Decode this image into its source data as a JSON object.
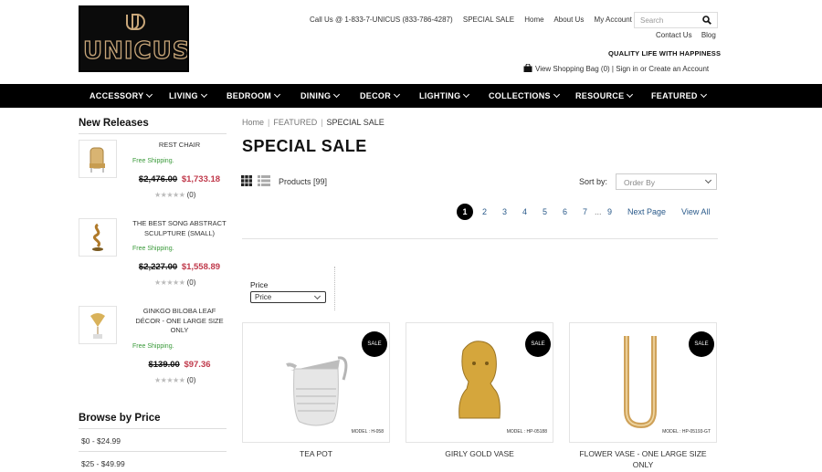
{
  "logo": {
    "text": "UNICUS"
  },
  "header": {
    "call": "Call Us @ 1-833-7-UNICUS (833-786-4287)",
    "special_sale": "SPECIAL SALE",
    "home": "Home",
    "about": "About Us",
    "account": "My Account",
    "search_placeholder": "Search",
    "contact": "Contact Us",
    "blog": "Blog",
    "tagline": "QUALITY LIFE WITH HAPPINESS",
    "bag": "View Shopping Bag (0)",
    "sign_in": "Sign in",
    "or": "or",
    "create": "Create an Account"
  },
  "nav": [
    "ACCESSORY",
    "LIVING",
    "BEDROOM",
    "DINING",
    "DECOR",
    "LIGHTING",
    "COLLECTIONS",
    "RESOURCE",
    "FEATURED"
  ],
  "sidebar": {
    "new_releases": "New Releases",
    "products": [
      {
        "name": "REST CHAIR",
        "shipping": "Free Shipping.",
        "old": "$2,476.00",
        "new": "$1,733.18",
        "reviews": "(0)"
      },
      {
        "name": "THE BEST SONG ABSTRACT SCULPTURE (SMALL)",
        "shipping": "Free Shipping.",
        "old": "$2,227.00",
        "new": "$1,558.89",
        "reviews": "(0)"
      },
      {
        "name": "GINKGO BILOBA LEAF DÉCOR - ONE LARGE SIZE ONLY",
        "shipping": "Free Shipping.",
        "old": "$139.00",
        "new": "$97.36",
        "reviews": "(0)"
      }
    ],
    "browse_title": "Browse by Price",
    "browse": [
      "$0 - $24.99",
      "$25 - $49.99"
    ]
  },
  "main": {
    "breadcrumb": [
      "Home",
      "FEATURED",
      "SPECIAL SALE"
    ],
    "title": "SPECIAL SALE",
    "count": "Products [99]",
    "sort_label": "Sort by:",
    "sort_value": "Order By",
    "pages": [
      "1",
      "2",
      "3",
      "4",
      "5",
      "6",
      "7",
      "...",
      "9"
    ],
    "next": "Next Page",
    "view_all": "View All",
    "filter_label": "Price",
    "filter_value": "Price",
    "products": [
      {
        "name": "TEA POT",
        "badge": "SALE",
        "model": "MODEL : H-058"
      },
      {
        "name": "GIRLY GOLD VASE",
        "badge": "SALE",
        "model": "MODEL : HP-05188"
      },
      {
        "name": "FLOWER VASE - ONE LARGE SIZE ONLY",
        "badge": "SALE",
        "model": "MODEL : HP-05193-GT"
      }
    ]
  },
  "colors": {
    "nav_bg": "#000000",
    "sale_price": "#c0394b",
    "shipping": "#3a9a3a",
    "gold": "#c9a77a"
  }
}
